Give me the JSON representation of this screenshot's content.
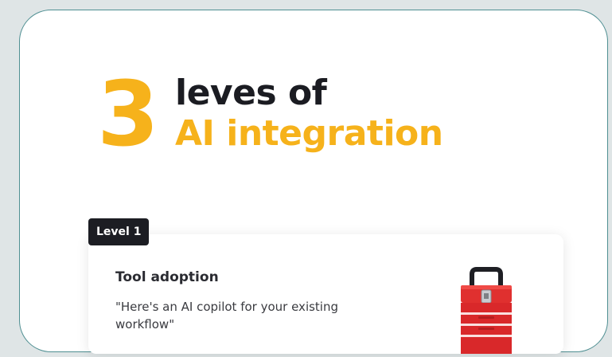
{
  "headline": {
    "number": "3",
    "line1": "leves of",
    "line2": "AI integration"
  },
  "level": {
    "badge": "Level 1",
    "title": "Tool adoption",
    "quote": "\"Here's an AI copilot for your existing workflow\""
  },
  "icons": {
    "toolbox": "toolbox-icon"
  },
  "colors": {
    "accent": "#f6b21b",
    "dark": "#1b1c22",
    "toolbox_red": "#e0302f"
  }
}
